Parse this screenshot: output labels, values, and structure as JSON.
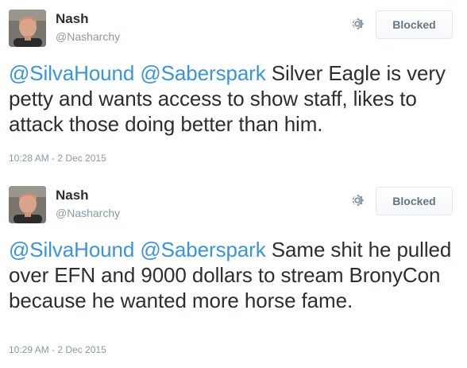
{
  "tweets": [
    {
      "name": "Nash",
      "handle": "@Nasharchy",
      "blocked_label": "Blocked",
      "mentions": [
        "@SilvaHound",
        "@Saberspark"
      ],
      "body": "Silver Eagle is very petty and wants access to show staff, likes to attack those doing better than him.",
      "timestamp": "10:28 AM - 2 Dec 2015"
    },
    {
      "name": "Nash",
      "handle": "@Nasharchy",
      "blocked_label": "Blocked",
      "mentions": [
        "@SilvaHound",
        "@Saberspark"
      ],
      "body": "Same shit he pulled over EFN and 9000 dollars to stream BronyCon because he wanted more horse fame.",
      "timestamp": "10:29 AM - 2 Dec 2015"
    }
  ],
  "colors": {
    "link": "#3b94d9",
    "text": "#292f33",
    "muted": "#8899a6",
    "button_text": "#66757f",
    "button_border": "#e1e8ed"
  },
  "icons": {
    "settings": "gear-icon"
  }
}
